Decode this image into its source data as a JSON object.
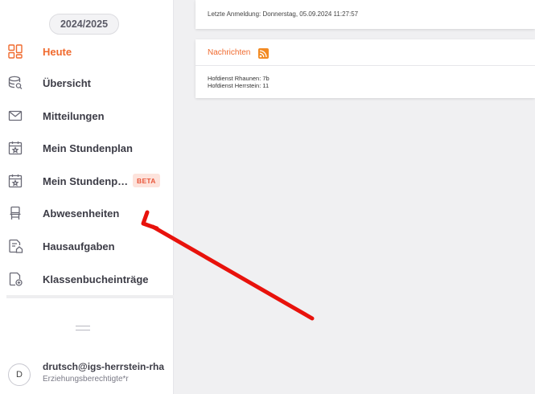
{
  "sidebar": {
    "school_year": "2024/2025",
    "items": [
      {
        "label": "Heute",
        "icon": "dashboard-icon",
        "active": true
      },
      {
        "label": "Übersicht",
        "icon": "overview-icon"
      },
      {
        "label": "Mitteilungen",
        "icon": "mail-icon"
      },
      {
        "label": "Mein Stundenplan",
        "icon": "calendar-star-icon"
      },
      {
        "label": "Mein Stundenp…",
        "icon": "calendar-star-icon",
        "badge": "BETA"
      },
      {
        "label": "Abwesenheiten",
        "icon": "chair-icon"
      },
      {
        "label": "Hausaufgaben",
        "icon": "homework-icon"
      },
      {
        "label": "Klassenbucheinträge",
        "icon": "classbook-entry-icon"
      }
    ],
    "user": {
      "initial": "D",
      "email": "drutsch@igs-herrstein-rha",
      "role": "Erziehungsberechtigte*r"
    }
  },
  "main": {
    "last_login": "Letzte Anmeldung: Donnerstag, 05.09.2024 11:27:57",
    "news": {
      "title": "Nachrichten",
      "lines": [
        "Hofdienst Rhaunen: 7b",
        "Hofdienst Herrstein: 11"
      ]
    }
  },
  "colors": {
    "accent": "#f06a2e",
    "annotation_arrow": "#e8120c",
    "rss": "#f28a22",
    "beta_bg": "#fde3dc",
    "beta_text": "#e8553a"
  }
}
